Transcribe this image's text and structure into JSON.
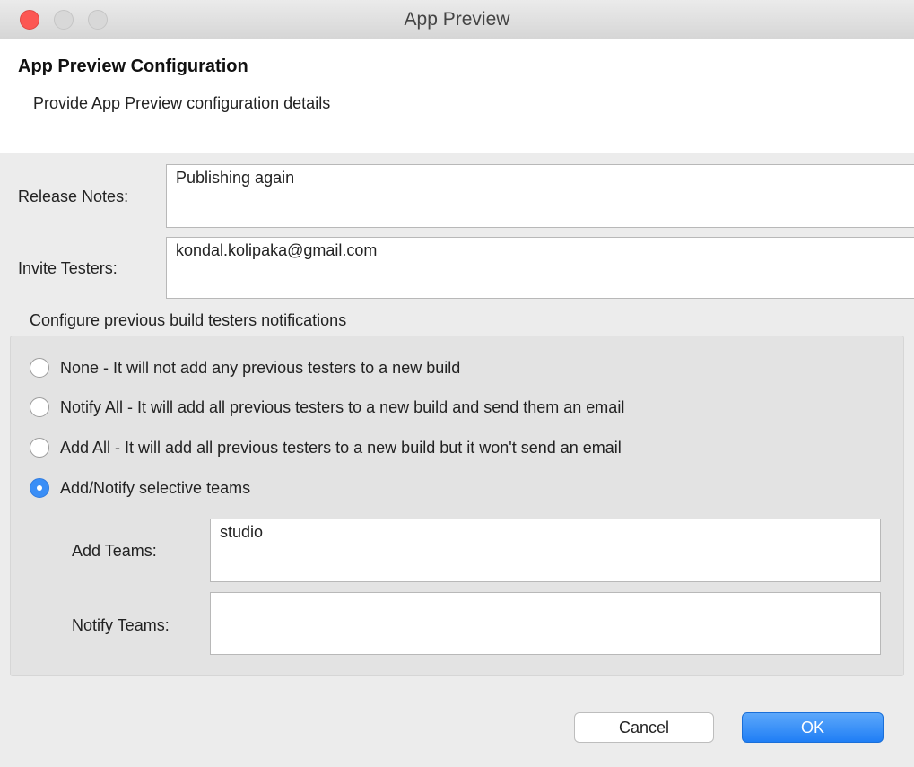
{
  "window": {
    "title": "App Preview"
  },
  "header": {
    "title": "App Preview Configuration",
    "description": "Provide App Preview configuration details"
  },
  "form": {
    "release_notes": {
      "label": "Release Notes:",
      "value": "Publishing again"
    },
    "invite_testers": {
      "label": "Invite Testers:",
      "value": "kondal.kolipaka@gmail.com"
    }
  },
  "notifications": {
    "group_label": "Configure previous build testers notifications",
    "options": [
      {
        "label": "None - It will not add any previous testers to a new build",
        "selected": false
      },
      {
        "label": "Notify All - It will add all previous testers to a new build and send them an email",
        "selected": false
      },
      {
        "label": "Add All - It will add all previous testers to a new build but it won't send an email",
        "selected": false
      },
      {
        "label": "Add/Notify selective teams",
        "selected": true
      }
    ],
    "add_teams": {
      "label": "Add Teams:",
      "value": "studio"
    },
    "notify_teams": {
      "label": "Notify Teams:",
      "value": ""
    }
  },
  "buttons": {
    "cancel": "Cancel",
    "ok": "OK"
  },
  "colors": {
    "accent": "#3a8ef6",
    "close_button": "#fc5753"
  }
}
